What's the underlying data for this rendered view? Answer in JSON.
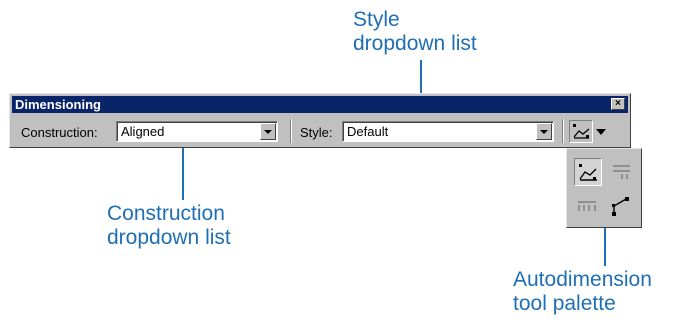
{
  "annotations": {
    "style": [
      "Style",
      "dropdown list"
    ],
    "construction": [
      "Construction",
      "dropdown list"
    ],
    "autodimension": [
      "Autodimension",
      "tool palette"
    ]
  },
  "toolbar": {
    "title": "Dimensioning",
    "close_glyph": "×",
    "construction_label": "Construction:",
    "construction_value": "Aligned",
    "style_label": "Style:",
    "style_value": "Default",
    "autodimension_icon": "aligned-dimension-icon"
  },
  "palette": {
    "tools": [
      {
        "icon": "aligned-dimension-icon",
        "active": true
      },
      {
        "icon": "parallel-dimension-icon",
        "active": false
      },
      {
        "icon": "horizontal-dimension-icon",
        "active": false
      },
      {
        "icon": "vertex-dimension-icon",
        "active": false
      }
    ]
  },
  "colors": {
    "annotation": "#1f6fb5",
    "titlebar": "#0a246a",
    "face": "#c0c0c0"
  }
}
